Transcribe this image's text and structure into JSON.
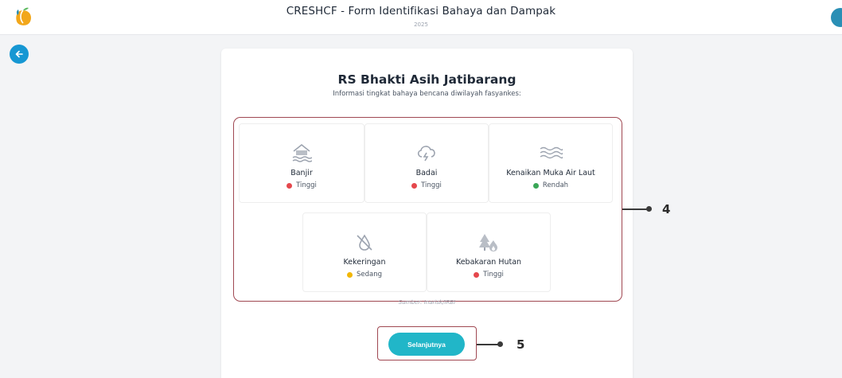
{
  "header": {
    "title": "CRESHCF - Form Identifikasi Bahaya dan Dampak",
    "year": "2025",
    "logo_icon": "creshcf-logo-icon",
    "avatar_icon": "user-avatar-icon"
  },
  "nav": {
    "back_icon": "arrow-left-icon"
  },
  "card": {
    "hospital": "RS Bhakti Asih Jatibarang",
    "subtitle": "Informasi tingkat bahaya bencana diwilayah fasyankes:",
    "source": "Sumber: Inarisk/IRBI",
    "next_label": "Selanjutnya"
  },
  "hazards": [
    {
      "name": "Banjir",
      "level": "Tinggi",
      "level_color": "#e5484d",
      "icon": "flood-house-icon"
    },
    {
      "name": "Badai",
      "level": "Tinggi",
      "level_color": "#e5484d",
      "icon": "storm-cloud-icon"
    },
    {
      "name": "Kenaikan Muka Air Laut",
      "level": "Rendah",
      "level_color": "#3aa657",
      "icon": "sea-waves-icon"
    },
    {
      "name": "Kekeringan",
      "level": "Sedang",
      "level_color": "#f2b705",
      "icon": "no-water-drop-icon"
    },
    {
      "name": "Kebakaran Hutan",
      "level": "Tinggi",
      "level_color": "#e5484d",
      "icon": "forest-fire-icon"
    }
  ],
  "callouts": {
    "hazards_marker": "4",
    "next_marker": "5"
  },
  "colors": {
    "accent": "#21b6c8",
    "back_button": "#1697d3",
    "highlight_frame": "#a04852",
    "background": "#f3f4f6"
  }
}
